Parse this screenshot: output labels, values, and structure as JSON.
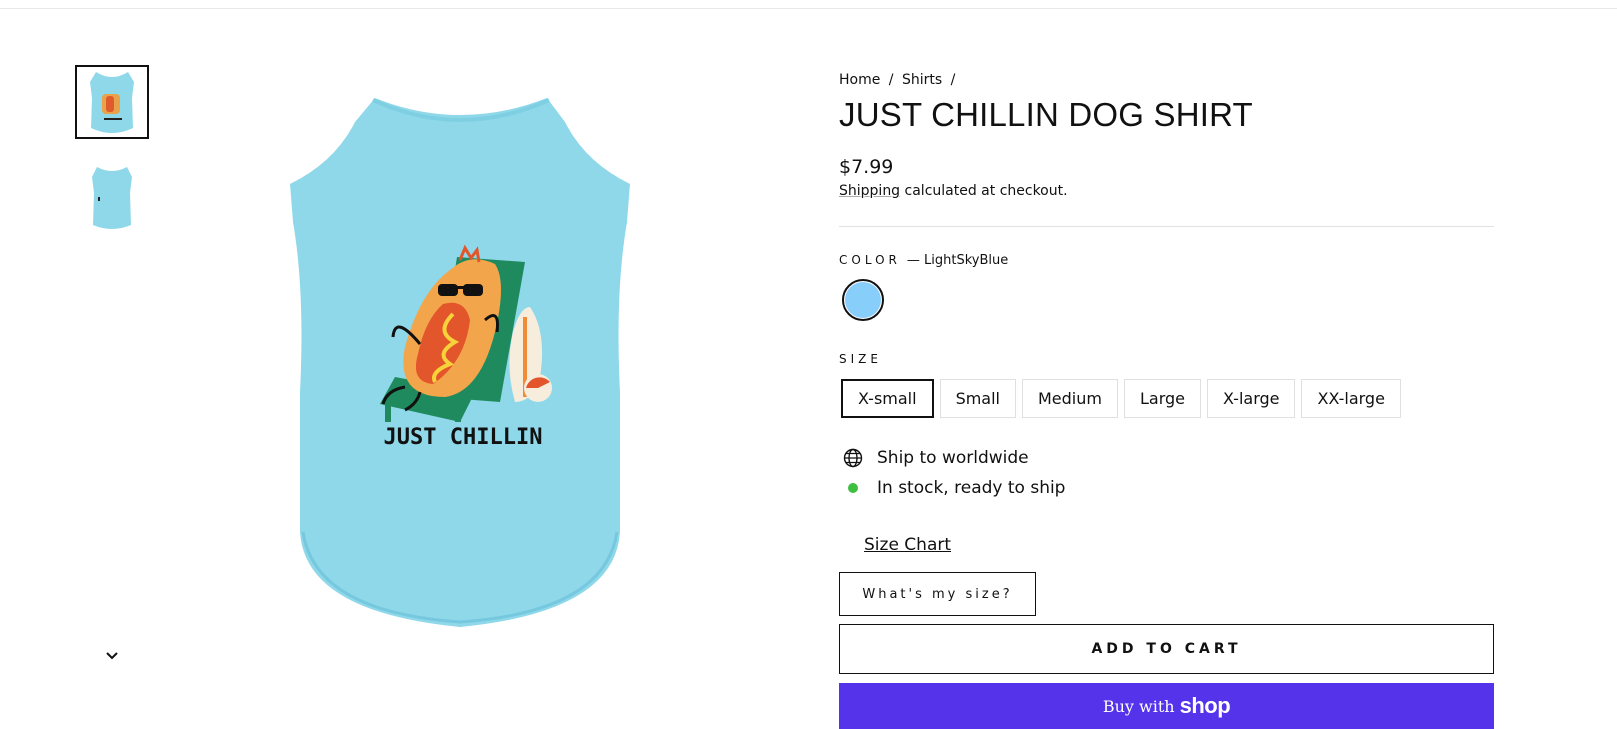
{
  "breadcrumb": {
    "home": "Home",
    "sep1": "/",
    "shirts": "Shirts",
    "sep2": "/"
  },
  "product": {
    "title": "JUST CHILLIN DOG SHIRT",
    "price": "$7.99",
    "shipping_link": "Shipping",
    "shipping_rest": " calculated at checkout.",
    "print_text": "JUST CHILLIN",
    "shirt_color": "#8fd8ea"
  },
  "options": {
    "color_label": "Color",
    "color_value": "— LightSkyBlue",
    "swatch_color": "#87cefa",
    "size_label": "Size",
    "sizes": [
      "X-small",
      "Small",
      "Medium",
      "Large",
      "X-large",
      "XX-large"
    ],
    "selected_size": "X-small"
  },
  "features": {
    "ship": "Ship to worldwide",
    "stock": "In stock, ready to ship",
    "stock_dot_color": "#3fbf3f"
  },
  "buttons": {
    "size_chart": "Size Chart",
    "whats_my_size": "What's my size?",
    "add_to_cart": "ADD TO CART",
    "buy_with": "Buy with",
    "shop_logo": "shop",
    "shop_color": "#5433eb"
  },
  "icons": {
    "globe": "globe-icon",
    "chevron": "chevron-down-icon"
  }
}
